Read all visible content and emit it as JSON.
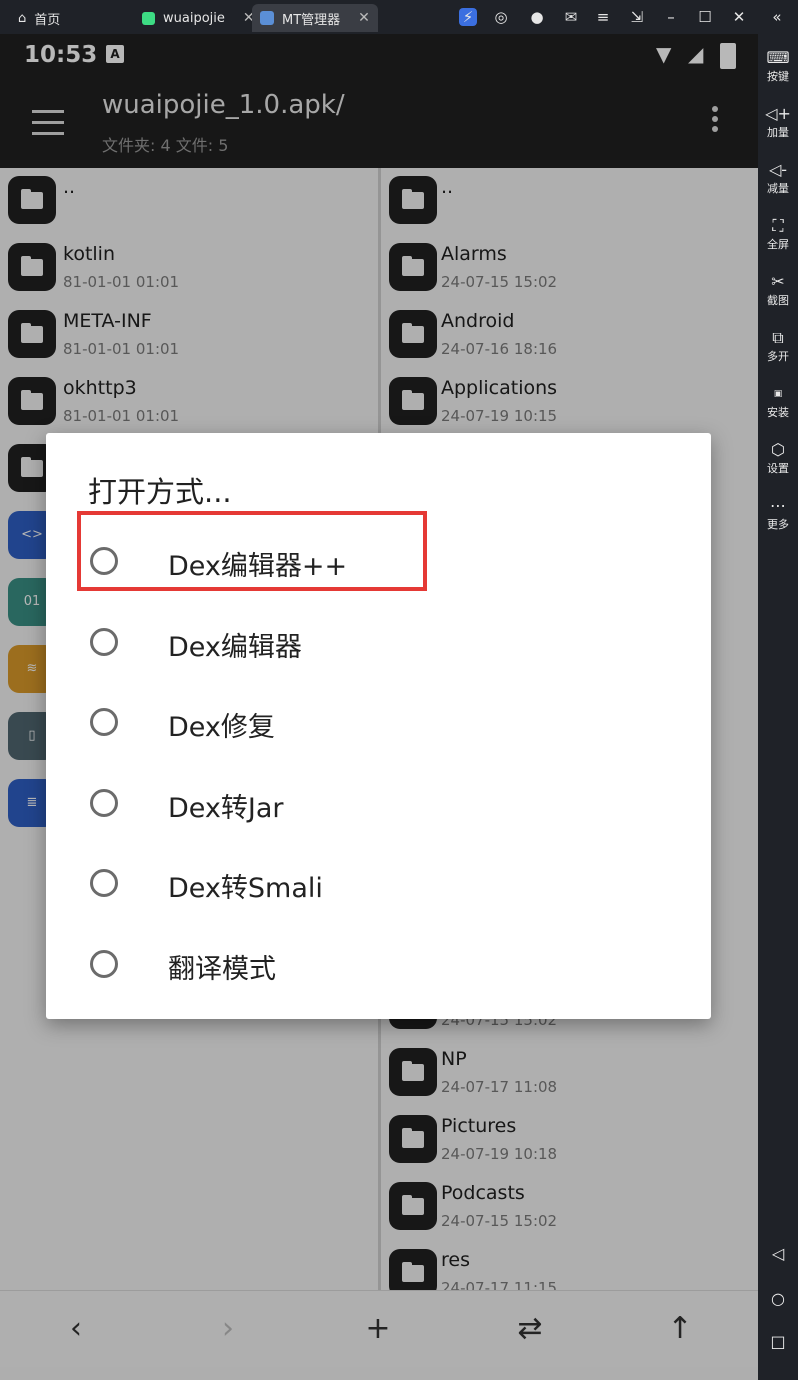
{
  "emulator": {
    "tabs": [
      {
        "label": "首页"
      },
      {
        "label": "wuaipojie"
      },
      {
        "label": "MT管理器"
      }
    ],
    "sidebar": [
      {
        "label": "按键",
        "icon": "keyboard-icon"
      },
      {
        "label": "加量",
        "icon": "volume-up-icon"
      },
      {
        "label": "减量",
        "icon": "volume-down-icon"
      },
      {
        "label": "全屏",
        "icon": "fullscreen-icon"
      },
      {
        "label": "截图",
        "icon": "scissors-icon"
      },
      {
        "label": "多开",
        "icon": "multi-open-icon"
      },
      {
        "label": "安装",
        "icon": "apk-install-icon"
      },
      {
        "label": "设置",
        "icon": "settings-icon"
      },
      {
        "label": "更多",
        "icon": "more-icon"
      }
    ]
  },
  "status": {
    "time": "10:53",
    "notification_icon": "A"
  },
  "appbar": {
    "title": "wuaipojie_1.0.apk/",
    "subtitle": "文件夹: 4  文件: 5"
  },
  "left_pane": [
    {
      "name": "..",
      "date": ""
    },
    {
      "name": "kotlin",
      "date": "81-01-01 01:01"
    },
    {
      "name": "META-INF",
      "date": "81-01-01 01:01"
    },
    {
      "name": "okhttp3",
      "date": "81-01-01 01:01"
    }
  ],
  "right_pane": [
    {
      "name": "..",
      "date": ""
    },
    {
      "name": "Alarms",
      "date": "24-07-15 15:02"
    },
    {
      "name": "Android",
      "date": "24-07-16 18:16"
    },
    {
      "name": "Applications",
      "date": "24-07-19 10:15"
    },
    {
      "name": "",
      "date": "24-07-15 15:02"
    },
    {
      "name": "NP",
      "date": "24-07-17 11:08"
    },
    {
      "name": "Pictures",
      "date": "24-07-19 10:18"
    },
    {
      "name": "Podcasts",
      "date": "24-07-15 15:02"
    },
    {
      "name": "res",
      "date": "24-07-17 11:15"
    }
  ],
  "dialog": {
    "title": "打开方式...",
    "options": [
      {
        "label": "Dex编辑器++"
      },
      {
        "label": "Dex编辑器"
      },
      {
        "label": "Dex修复"
      },
      {
        "label": "Dex转Jar"
      },
      {
        "label": "Dex转Smali"
      },
      {
        "label": "翻译模式"
      }
    ]
  },
  "colors": {
    "highlight": "#e53935",
    "appbar": "#202020"
  }
}
